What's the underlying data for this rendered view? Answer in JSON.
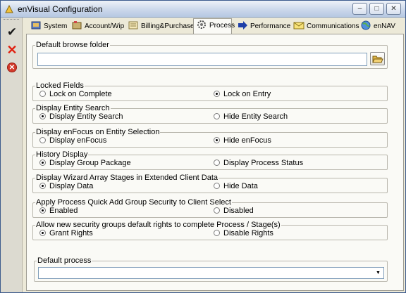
{
  "window": {
    "title": "enVisual Configuration"
  },
  "toolbar": {
    "items": [
      "checkmark-icon",
      "red-x-icon",
      "stop-icon"
    ]
  },
  "tabs": [
    {
      "label": "System",
      "icon": "system-icon"
    },
    {
      "label": "Account/Wip",
      "icon": "account-icon"
    },
    {
      "label": "Billing&Purchase",
      "icon": "billing-icon"
    },
    {
      "label": "Process",
      "icon": "gear-icon"
    },
    {
      "label": "Performance",
      "icon": "arrow-icon"
    },
    {
      "label": "Communications",
      "icon": "communications-icon"
    },
    {
      "label": "enNAV",
      "icon": "globe-icon"
    }
  ],
  "active_tab": "Process",
  "default_browse_folder": {
    "legend": "Default browse folder",
    "value": ""
  },
  "groups": [
    {
      "legend": "Locked Fields",
      "options": [
        "Lock on Complete",
        "Lock on Entry"
      ],
      "selected": 1
    },
    {
      "legend": "Display Entity Search",
      "options": [
        "Display Entity Search",
        "Hide Entity Search"
      ],
      "selected": 0
    },
    {
      "legend": "Display enFocus on Entity Selection",
      "options": [
        "Display enFocus",
        "Hide enFocus"
      ],
      "selected": 1
    },
    {
      "legend": "History Display",
      "options": [
        "Display Group Package",
        "Display Process Status"
      ],
      "selected": 0
    },
    {
      "legend": "Display Wizard Array Stages in Extended Client Data",
      "options": [
        "Display Data",
        "Hide Data"
      ],
      "selected": 0
    },
    {
      "legend": "Apply Process Quick Add Group Security to Client Select",
      "options": [
        "Enabled",
        "Disabled"
      ],
      "selected": 0
    },
    {
      "legend": "Allow new security groups default rights to complete Process / Stage(s)",
      "options": [
        "Grant Rights",
        "Disable Rights"
      ],
      "selected": 0
    }
  ],
  "default_process": {
    "legend": "Default process",
    "value": ""
  }
}
